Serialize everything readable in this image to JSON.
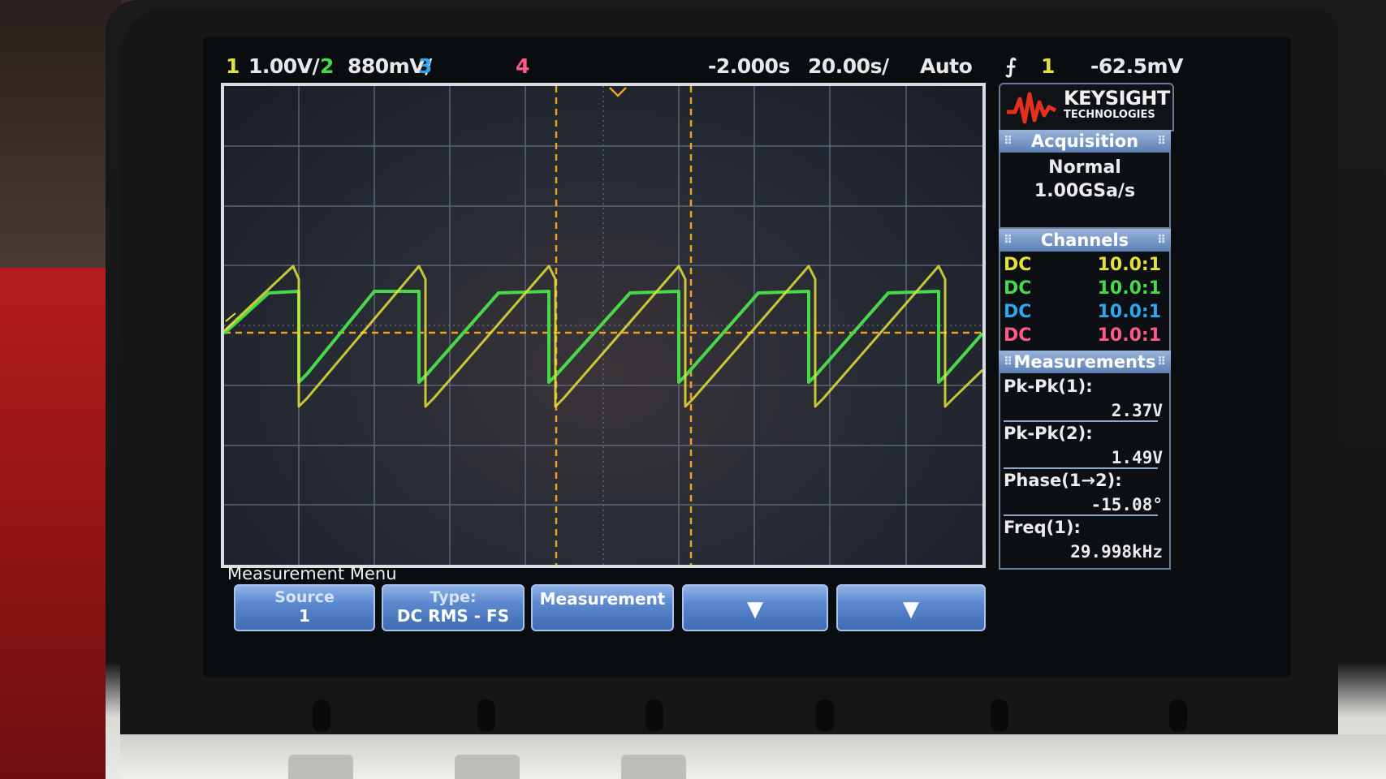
{
  "topbar": {
    "ch1_num": "1",
    "ch1_scale": "1.00V/",
    "ch2_num": "2",
    "ch2_scale": "880mV/",
    "ch3_num": "3",
    "ch4_num": "4",
    "time_offset": "-2.000s",
    "time_scale": "20.00s/",
    "trigger_mode": "Auto",
    "trigger_icon": "trigger-edge-icon",
    "trigger_source": "1",
    "trigger_level": "-62.5mV"
  },
  "logo": {
    "name": "KEYSIGHT",
    "sub": "TECHNOLOGIES"
  },
  "acquisition": {
    "title": "Acquisition",
    "mode": "Normal",
    "rate": "1.00GSa/s"
  },
  "channels": {
    "title": "Channels",
    "rows": [
      {
        "coupling": "DC",
        "probe": "10.0:1",
        "color": "#e6e03a"
      },
      {
        "coupling": "DC",
        "probe": "10.0:1",
        "color": "#49d84a"
      },
      {
        "coupling": "DC",
        "probe": "10.0:1",
        "color": "#2fa6f0"
      },
      {
        "coupling": "DC",
        "probe": "10.0:1",
        "color": "#ff5a87"
      }
    ]
  },
  "measurements": {
    "title": "Measurements",
    "items": [
      {
        "label": "Pk-Pk(1):",
        "value": "2.37V"
      },
      {
        "label": "Pk-Pk(2):",
        "value": "1.49V"
      },
      {
        "label": "Phase(1→2):",
        "value": "-15.08°"
      },
      {
        "label": "Freq(1):",
        "value": "29.998kHz"
      }
    ]
  },
  "menu": {
    "title": "Measurement Menu",
    "softkeys": [
      {
        "top": "Source",
        "bottom": "1"
      },
      {
        "top": "Type:",
        "bottom": "DC RMS - FS"
      },
      {
        "top": "",
        "bottom": "Measurement"
      },
      {
        "top": "",
        "bottom": "",
        "icon": "down-arrow-icon"
      },
      {
        "top": "",
        "bottom": "",
        "icon": "down-arrow-icon"
      }
    ]
  },
  "colors": {
    "ch1": "#e6e03a",
    "ch2": "#49d84a",
    "ch3": "#2fa6f0",
    "ch4": "#ff5a87",
    "cursor": "#f0a020"
  }
}
